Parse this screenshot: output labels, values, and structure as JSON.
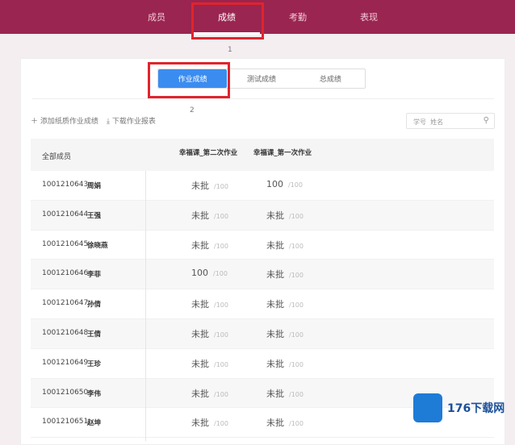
{
  "nav": {
    "items": [
      "成员",
      "成绩",
      "考勤",
      "表现"
    ],
    "active": 1
  },
  "annotations": [
    "1",
    "2"
  ],
  "tabs": [
    "作业成绩",
    "测试成绩",
    "总成绩"
  ],
  "toolbar": {
    "add_label": "添加纸质作业成绩",
    "download_label": "下载作业报表"
  },
  "search": {
    "field_label": "学号",
    "placeholder": "姓名"
  },
  "table": {
    "all_members": "全部成员",
    "columns": [
      "幸福课_第二次作业",
      "幸福课_第一次作业"
    ],
    "max": "/100",
    "rows": [
      {
        "id": "1001210643",
        "name": "周娟",
        "scores": [
          "未批",
          "100"
        ]
      },
      {
        "id": "1001210644",
        "name": "王强",
        "scores": [
          "未批",
          "未批"
        ]
      },
      {
        "id": "1001210645",
        "name": "徐晓燕",
        "scores": [
          "未批",
          "未批"
        ]
      },
      {
        "id": "1001210646",
        "name": "李菲",
        "scores": [
          "100",
          "未批"
        ]
      },
      {
        "id": "1001210647",
        "name": "孙倩",
        "scores": [
          "未批",
          "未批"
        ]
      },
      {
        "id": "1001210648",
        "name": "王倩",
        "scores": [
          "未批",
          "未批"
        ]
      },
      {
        "id": "1001210649",
        "name": "王珍",
        "scores": [
          "未批",
          "未批"
        ]
      },
      {
        "id": "1001210650",
        "name": "李伟",
        "scores": [
          "未批",
          "未批"
        ]
      },
      {
        "id": "1001210651",
        "name": "赵坤",
        "scores": [
          "未批",
          "未批"
        ]
      }
    ]
  },
  "watermark": "176下载网",
  "colors": {
    "header": "#9a2550",
    "accent": "#3b8cf0",
    "annotation": "#e0242c"
  }
}
